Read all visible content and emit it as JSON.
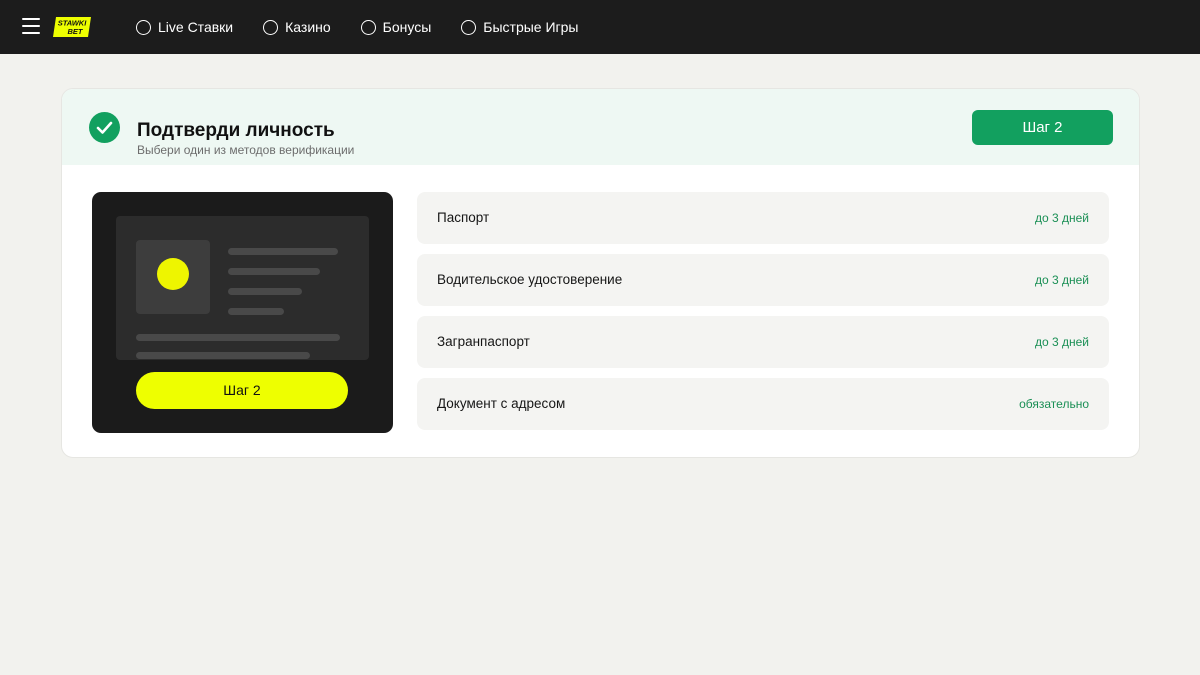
{
  "brand": {
    "logo_text": "STAWKI BET",
    "logo_color": "#eeff00"
  },
  "nav": {
    "menu_icon": "hamburger-icon",
    "items": [
      {
        "label": "Live Ставки",
        "icon": "circle-icon"
      },
      {
        "label": "Казино",
        "icon": "circle-icon"
      },
      {
        "label": "Бонусы",
        "icon": "circle-icon"
      },
      {
        "label": "Быстрые Игры",
        "icon": "circle-icon"
      }
    ]
  },
  "verify": {
    "title": "Подтверди личность",
    "subtitle": "Выбери один из методов верификации",
    "step_button": "Шаг 2",
    "status_icon": "check-circle-icon",
    "accent_color": "#12a05f"
  },
  "illustration": {
    "button_label": "Шаг 2",
    "button_color": "#eeff00"
  },
  "options": [
    {
      "label": "Паспорт",
      "time": "до 3 дней"
    },
    {
      "label": "Водительское удостоверение",
      "time": "до 3 дней"
    },
    {
      "label": "Загранпаспорт",
      "time": "до 3 дней"
    },
    {
      "label": "Документ с адресом",
      "time": "обязательно"
    }
  ]
}
